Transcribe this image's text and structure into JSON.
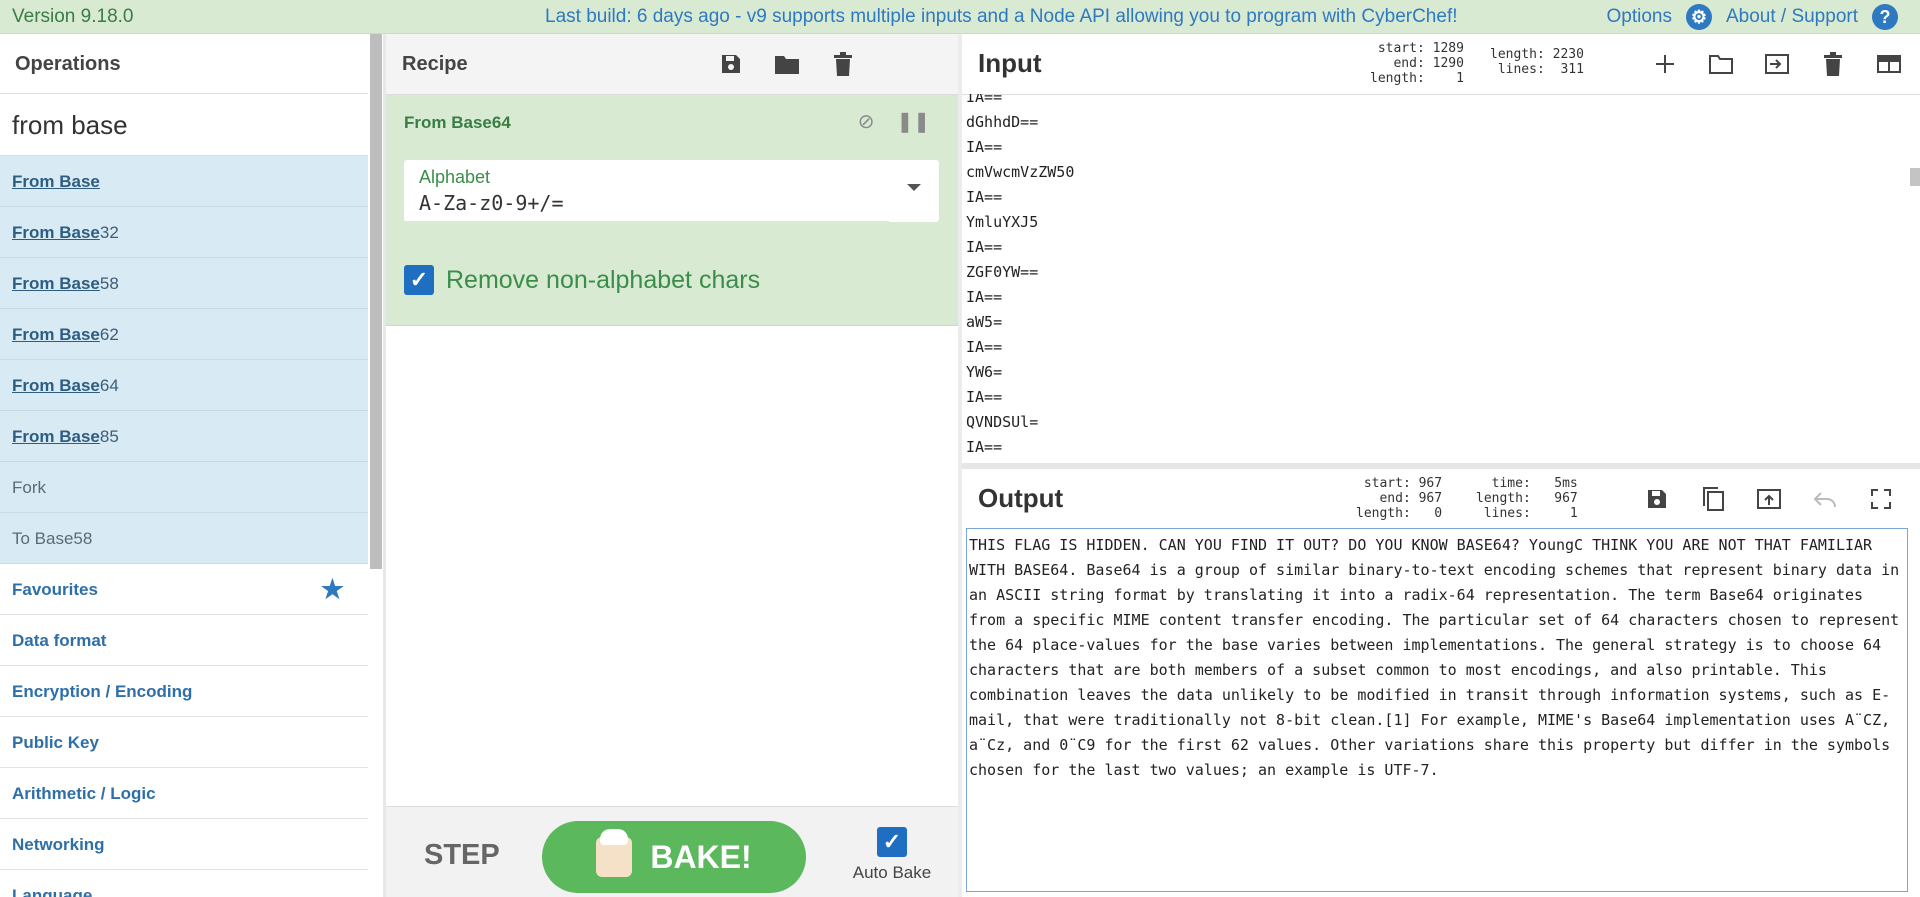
{
  "topbar": {
    "version": "Version 9.18.0",
    "build": "Last build: 6 days ago - v9 supports multiple inputs and a Node API allowing you to program with CyberChef!",
    "options": "Options",
    "about": "About / Support"
  },
  "operations": {
    "title": "Operations",
    "search_value": "from base",
    "results": [
      {
        "match": "From Base",
        "rest": ""
      },
      {
        "match": "From Base",
        "rest": "32"
      },
      {
        "match": "From Base",
        "rest": "58"
      },
      {
        "match": "From Base",
        "rest": "62"
      },
      {
        "match": "From Base",
        "rest": "64"
      },
      {
        "match": "From Base",
        "rest": "85"
      },
      {
        "match": "",
        "rest": "Fork"
      },
      {
        "match": "",
        "rest": "To Base58"
      }
    ],
    "categories": [
      "Favourites",
      "Data format",
      "Encryption / Encoding",
      "Public Key",
      "Arithmetic / Logic",
      "Networking",
      "Language"
    ]
  },
  "recipe": {
    "title": "Recipe",
    "op_name": "From Base64",
    "alphabet_label": "Alphabet",
    "alphabet_value": "A-Za-z0-9+/=",
    "remove_label": "Remove non-alphabet chars",
    "step": "STEP",
    "bake": "BAKE!",
    "auto_bake": "Auto Bake"
  },
  "input": {
    "title": "Input",
    "stats_left": "start: 1289\n  end: 1290\nlength:    1",
    "stats_right": "length: 2230\n lines:  311",
    "lines": [
      "IA==",
      "dGhhdD==",
      "IA==",
      "cmVwcmVzZW50",
      "IA==",
      "YmluYXJ5",
      "IA==",
      "ZGF0YW==",
      "IA==",
      "aW5=",
      "IA==",
      "YW6=",
      "IA==",
      "QVNDSUl=",
      "IA=="
    ]
  },
  "output": {
    "title": "Output",
    "stats_left": "start: 967\n  end: 967\nlength:   0",
    "stats_right": "  time:   5ms\nlength:   967\n lines:     1",
    "text": "THIS FLAG IS HIDDEN. CAN YOU FIND IT OUT? DO YOU KNOW BASE64? YoungC THINK YOU ARE NOT THAT FAMILIAR WITH BASE64. Base64 is a group of similar binary-to-text encoding schemes that represent binary data in an ASCII string format by translating it into a radix-64 representation. The term Base64 originates from a specific MIME content transfer encoding. The particular set of 64 characters chosen to represent the 64 place-values for the base varies between implementations. The general strategy is to choose 64 characters that are both members of a subset common to most encodings, and also printable. This combination leaves the data unlikely to be modified in transit through information systems, such as E-mail, that were traditionally not 8-bit clean.[1] For example, MIME's Base64 implementation uses A¨CZ, a¨Cz, and 0¨C9 for the first 62 values. Other variations share this property but differ in the symbols chosen for the last two values; an example is UTF-7."
  }
}
